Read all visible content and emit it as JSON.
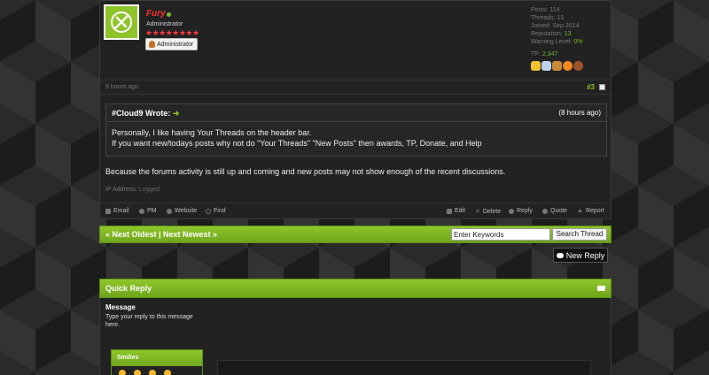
{
  "post": {
    "username": "Fury",
    "user_title": "Administrator",
    "stars": "★★★★★★★★",
    "group_label": "Administrator",
    "stats": {
      "posts": "Posts: 114",
      "threads": "Threads: 15",
      "joined": "Joined: Sep 2014",
      "reputation_label": "Reputation: ",
      "reputation_value": "13",
      "warning_label": "Warning Level: ",
      "warning_value": "0%"
    },
    "tp_label": "TP: ",
    "tp_value": "2,347",
    "awards": [
      {
        "icon": "crown-award-icon",
        "color": "#f2c230"
      },
      {
        "icon": "wings-award-icon",
        "color": "#bcd2e8"
      },
      {
        "icon": "character-award-icon",
        "color": "#c98a3a"
      },
      {
        "icon": "pumpkin-award-icon",
        "color": "#f08a1c"
      },
      {
        "icon": "turkey-award-icon",
        "color": "#a0522d"
      }
    ],
    "time": "6 hours ago",
    "number": "#3",
    "quote": {
      "author": "#Cloud9 Wrote:",
      "time": "(8 hours ago)",
      "line1": "Personally, I like having Your Threads on the header bar.",
      "line2": "If you want new/todays posts why not do \"Your Threads\" \"New Posts\" then awards, TP, Donate, and Help"
    },
    "body": "Because the forums activity is still up and coming and new posts may not show enough of the recent discussions.",
    "ip_label": "IP Address: ",
    "ip_value": "Logged",
    "actions_left": [
      "Email",
      "PM",
      "Website",
      "Find"
    ],
    "actions_right": [
      "Edit",
      "Delete",
      "Reply",
      "Quote",
      "Report"
    ]
  },
  "navbar": {
    "links": "« Next Oldest | Next Newest »",
    "keywords_value": "Enter Keywords",
    "search_label": "Search Thread"
  },
  "new_reply_label": "New Reply",
  "quick_reply": {
    "title": "Quick Reply",
    "message_label": "Message",
    "message_hint": "Type your reply to this message here.",
    "smilies_label": "Smilies"
  },
  "colors": {
    "accent": "#8fc72b",
    "username": "#ff2e2e"
  }
}
